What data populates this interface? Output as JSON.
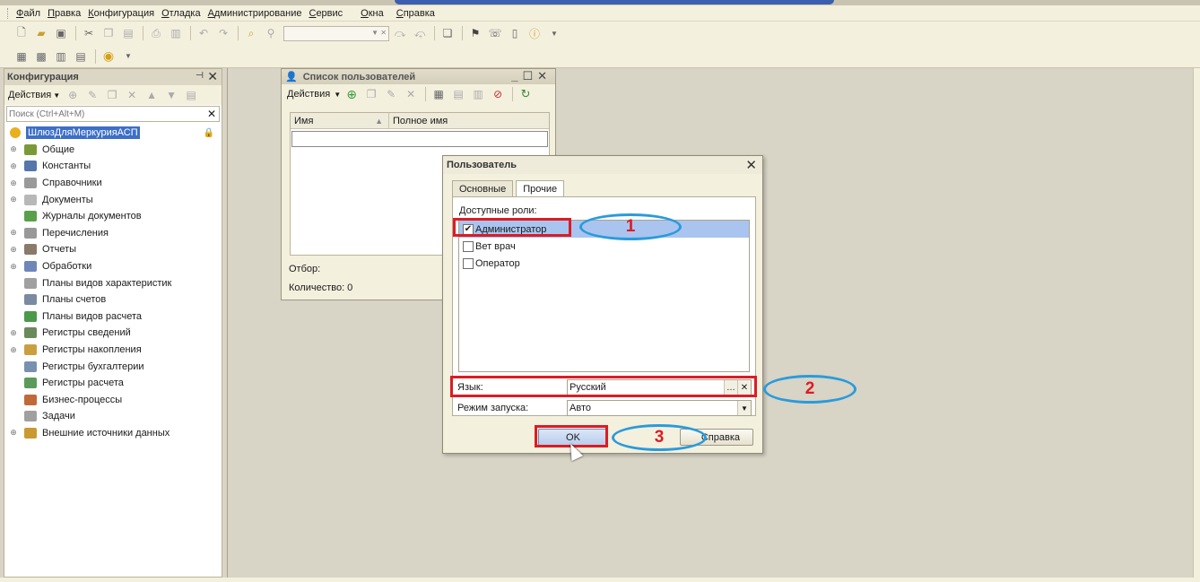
{
  "menu": [
    "Файл",
    "Правка",
    "Конфигурация",
    "Отладка",
    "Администрирование",
    "Сервис",
    "Окна",
    "Справка"
  ],
  "config_panel": {
    "title": "Конфигурация",
    "actions_label": "Действия",
    "search_placeholder": "Поиск (Ctrl+Alt+M)",
    "root": "ШлюзДляМеркурияАСП",
    "items": [
      {
        "label": "Общие",
        "expandable": true,
        "color": "#7a9a3a"
      },
      {
        "label": "Константы",
        "expandable": true,
        "color": "#5577aa"
      },
      {
        "label": "Справочники",
        "expandable": true,
        "color": "#9a9a9a"
      },
      {
        "label": "Документы",
        "expandable": true,
        "color": "#b8b8b8"
      },
      {
        "label": "Журналы документов",
        "expandable": false,
        "color": "#5aa04a"
      },
      {
        "label": "Перечисления",
        "expandable": true,
        "color": "#999999"
      },
      {
        "label": "Отчеты",
        "expandable": true,
        "color": "#8a7a6a"
      },
      {
        "label": "Обработки",
        "expandable": true,
        "color": "#6f86b8"
      },
      {
        "label": "Планы видов характеристик",
        "expandable": false,
        "color": "#a0a0a0"
      },
      {
        "label": "Планы счетов",
        "expandable": false,
        "color": "#7a8aa0"
      },
      {
        "label": "Планы видов расчета",
        "expandable": false,
        "color": "#4a9a4a"
      },
      {
        "label": "Регистры сведений",
        "expandable": true,
        "color": "#6a8a5a"
      },
      {
        "label": "Регистры накопления",
        "expandable": true,
        "color": "#c9a040"
      },
      {
        "label": "Регистры бухгалтерии",
        "expandable": false,
        "color": "#7a90b0"
      },
      {
        "label": "Регистры расчета",
        "expandable": false,
        "color": "#5a9a5a"
      },
      {
        "label": "Бизнес-процессы",
        "expandable": false,
        "color": "#c06a3a"
      },
      {
        "label": "Задачи",
        "expandable": false,
        "color": "#a0a0a0"
      },
      {
        "label": "Внешние источники данных",
        "expandable": true,
        "color": "#c99a30"
      }
    ]
  },
  "users_window": {
    "title": "Список пользователей",
    "actions_label": "Действия",
    "columns": [
      "Имя",
      "Полное имя"
    ],
    "filter_label": "Отбор:",
    "count_label": "Количество: 0"
  },
  "user_dialog": {
    "title": "Пользователь",
    "tabs": [
      "Основные",
      "Прочие"
    ],
    "active_tab": "Прочие",
    "roles_label": "Доступные роли:",
    "roles": [
      {
        "label": "Администратор",
        "checked": true,
        "selected": true
      },
      {
        "label": "Вет врач",
        "checked": false,
        "selected": false
      },
      {
        "label": "Оператор",
        "checked": false,
        "selected": false
      }
    ],
    "language_label": "Язык:",
    "language_value": "Русский",
    "launch_mode_label": "Режим запуска:",
    "launch_mode_value": "Авто",
    "ok_label": "OK",
    "help_label": "Справка"
  },
  "annotations": [
    "1",
    "2",
    "3"
  ]
}
